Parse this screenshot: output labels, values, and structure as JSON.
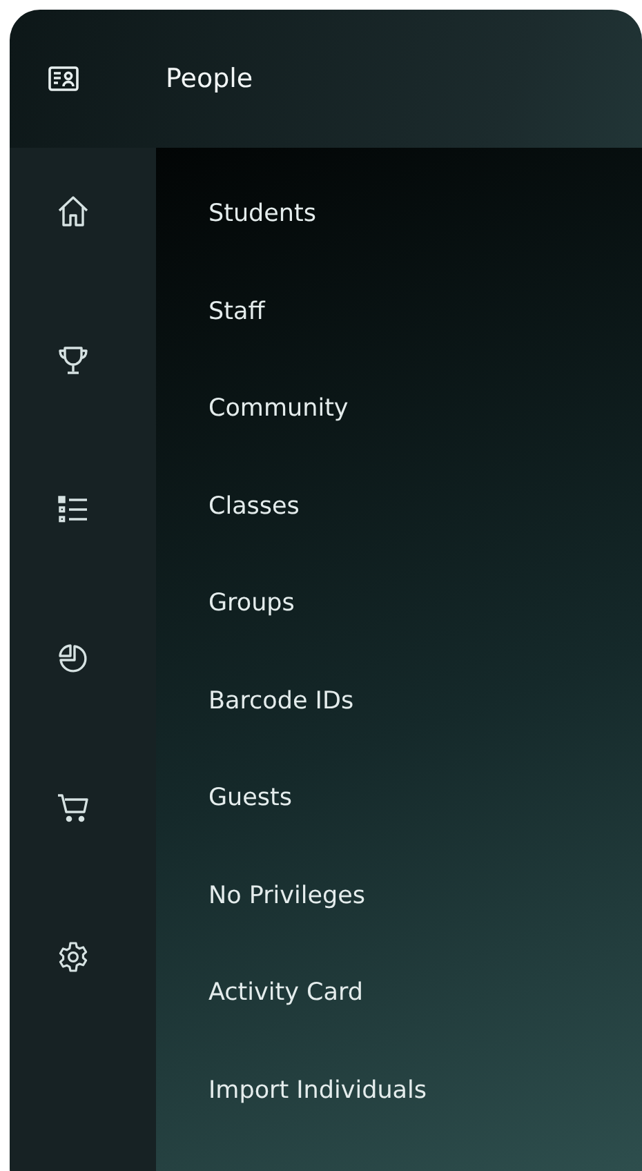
{
  "header": {
    "title": "People"
  },
  "rail": [
    {
      "kind": "home"
    },
    {
      "kind": "trophy"
    },
    {
      "kind": "list"
    },
    {
      "kind": "pie"
    },
    {
      "kind": "cart"
    },
    {
      "kind": "gear"
    }
  ],
  "menu": [
    {
      "label": "Students"
    },
    {
      "label": "Staff"
    },
    {
      "label": "Community"
    },
    {
      "label": "Classes"
    },
    {
      "label": "Groups"
    },
    {
      "label": "Barcode IDs"
    },
    {
      "label": "Guests"
    },
    {
      "label": "No Privileges"
    },
    {
      "label": "Activity Card"
    },
    {
      "label": "Import Individuals"
    }
  ]
}
